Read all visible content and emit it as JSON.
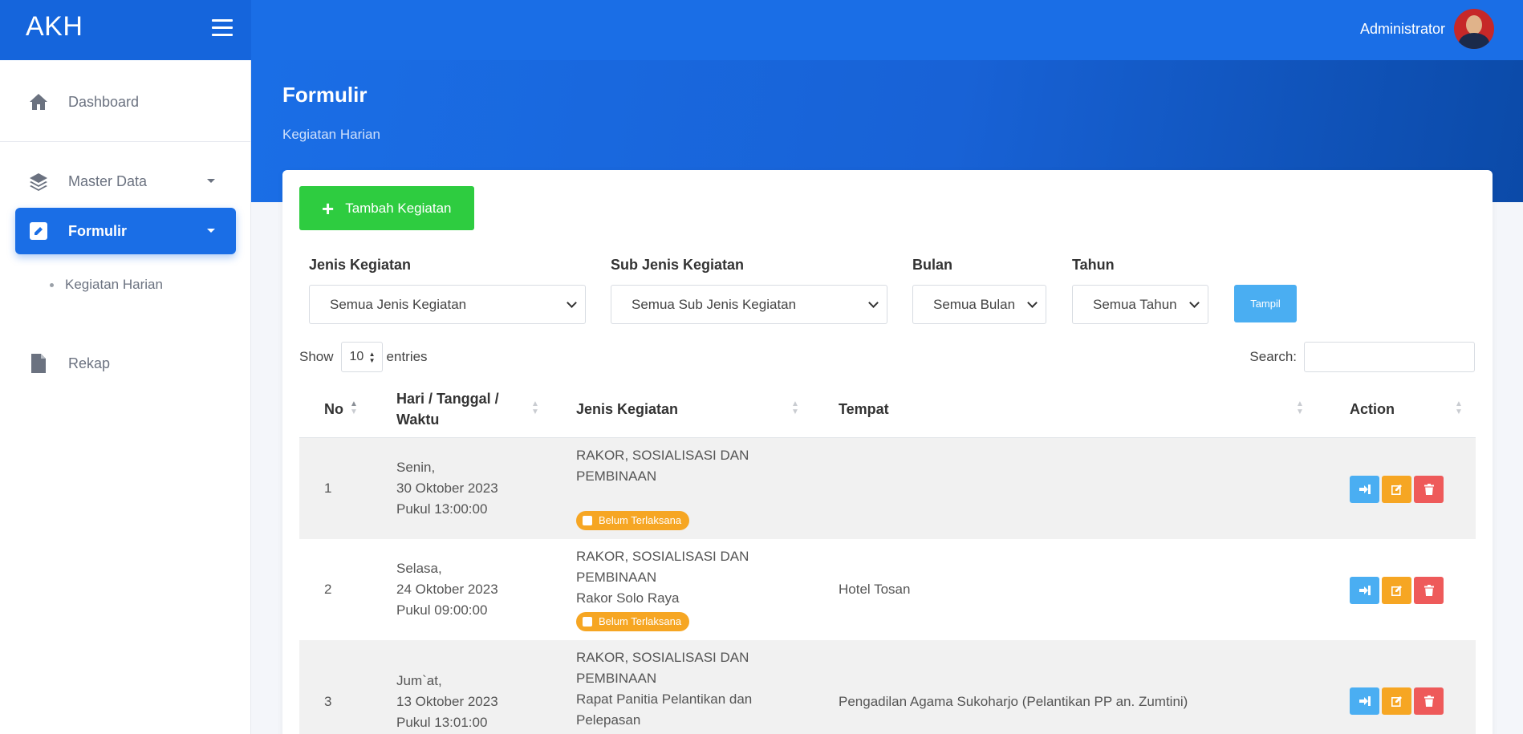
{
  "app": {
    "brand": "AKH",
    "user": "Administrator"
  },
  "sidebar": {
    "items": [
      {
        "label": "Dashboard",
        "icon": "home-icon"
      },
      {
        "label": "Master Data",
        "icon": "layers-icon"
      },
      {
        "label": "Formulir",
        "icon": "edit-icon",
        "active": true
      },
      {
        "label": "Rekap",
        "icon": "file-icon"
      }
    ],
    "sub_items": [
      {
        "label": "Kegiatan Harian"
      }
    ]
  },
  "page": {
    "title": "Formulir",
    "subtitle": "Kegiatan Harian"
  },
  "toolbar": {
    "add_label": "Tambah Kegiatan"
  },
  "filters": [
    {
      "label": "Jenis Kegiatan",
      "value": "Semua Jenis Kegiatan"
    },
    {
      "label": "Sub Jenis Kegiatan",
      "value": "Semua Sub Jenis Kegiatan"
    },
    {
      "label": "Bulan",
      "value": "Semua Bulan"
    },
    {
      "label": "Tahun",
      "value": "Semua Tahun"
    }
  ],
  "filter_button": "Tampil",
  "table_controls": {
    "show_label": "Show",
    "entries_value": "10",
    "entries_label": "entries",
    "search_label": "Search:"
  },
  "table": {
    "columns": [
      "No",
      "Hari / Tanggal / Waktu",
      "Jenis Kegiatan",
      "Tempat",
      "Action"
    ],
    "rows": [
      {
        "no": "1",
        "day": "Senin,",
        "date": "30 Oktober 2023",
        "time": "Pukul 13:00:00",
        "jenis": "RAKOR, SOSIALISASI DAN PEMBINAAN",
        "detail": "",
        "status": "Belum Terlaksana",
        "tempat": ""
      },
      {
        "no": "2",
        "day": "Selasa,",
        "date": "24 Oktober 2023",
        "time": "Pukul 09:00:00",
        "jenis": "RAKOR, SOSIALISASI DAN PEMBINAAN",
        "detail": "Rakor Solo Raya",
        "status": "Belum Terlaksana",
        "tempat": "Hotel Tosan"
      },
      {
        "no": "3",
        "day": "Jum`at,",
        "date": "13 Oktober 2023",
        "time": "Pukul 13:01:00",
        "jenis": "RAKOR, SOSIALISASI DAN PEMBINAAN",
        "detail": "Rapat Panitia Pelantikan dan Pelepasan",
        "status": "",
        "tempat": "Pengadilan Agama Sukoharjo (Pelantikan PP an. Zumtini)"
      }
    ]
  },
  "colors": {
    "primary": "#1a6ee6",
    "success": "#2ecc40",
    "info": "#4aaef2",
    "warning": "#f6a623",
    "danger": "#ee5a5a"
  }
}
